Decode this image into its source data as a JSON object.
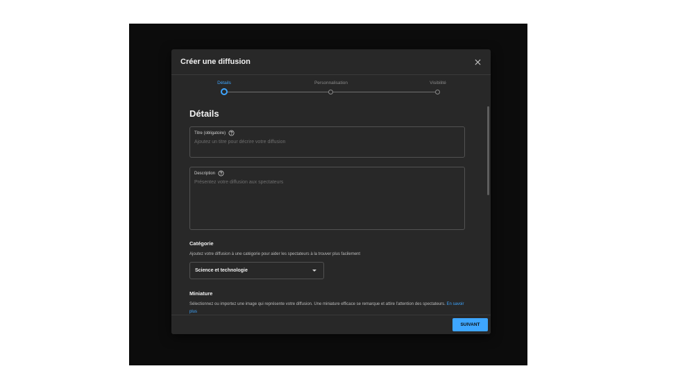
{
  "dialog": {
    "title": "Créer une diffusion",
    "close_icon": "close-icon"
  },
  "stepper": {
    "steps": [
      {
        "label": "Détails",
        "state": "active"
      },
      {
        "label": "Personnalisation",
        "state": "inactive"
      },
      {
        "label": "Visibilité",
        "state": "inactive"
      }
    ]
  },
  "details": {
    "heading": "Détails",
    "title_field": {
      "label": "Titre (obligatoire)",
      "placeholder": "Ajoutez un titre pour décrire votre diffusion",
      "help_icon": "help-circle-icon"
    },
    "description_field": {
      "label": "Description",
      "placeholder": "Présentez votre diffusion aux spectateurs",
      "help_icon": "help-circle-icon"
    },
    "category": {
      "heading": "Catégorie",
      "text": "Ajoutez votre diffusion à une catégorie pour aider les spectateurs à la trouver plus facilement",
      "selected": "Science et technologie"
    },
    "thumbnail": {
      "heading": "Miniature",
      "text": "Sélectionnez ou importez une image qui représente votre diffusion. Une miniature efficace se remarque et attire l'attention des spectateurs.",
      "link": "En savoir plus"
    }
  },
  "footer": {
    "next_label": "SUIVANT"
  },
  "colors": {
    "accent": "#3ea6ff",
    "dialog_bg": "#282828",
    "backdrop": "#0c0c0c"
  }
}
